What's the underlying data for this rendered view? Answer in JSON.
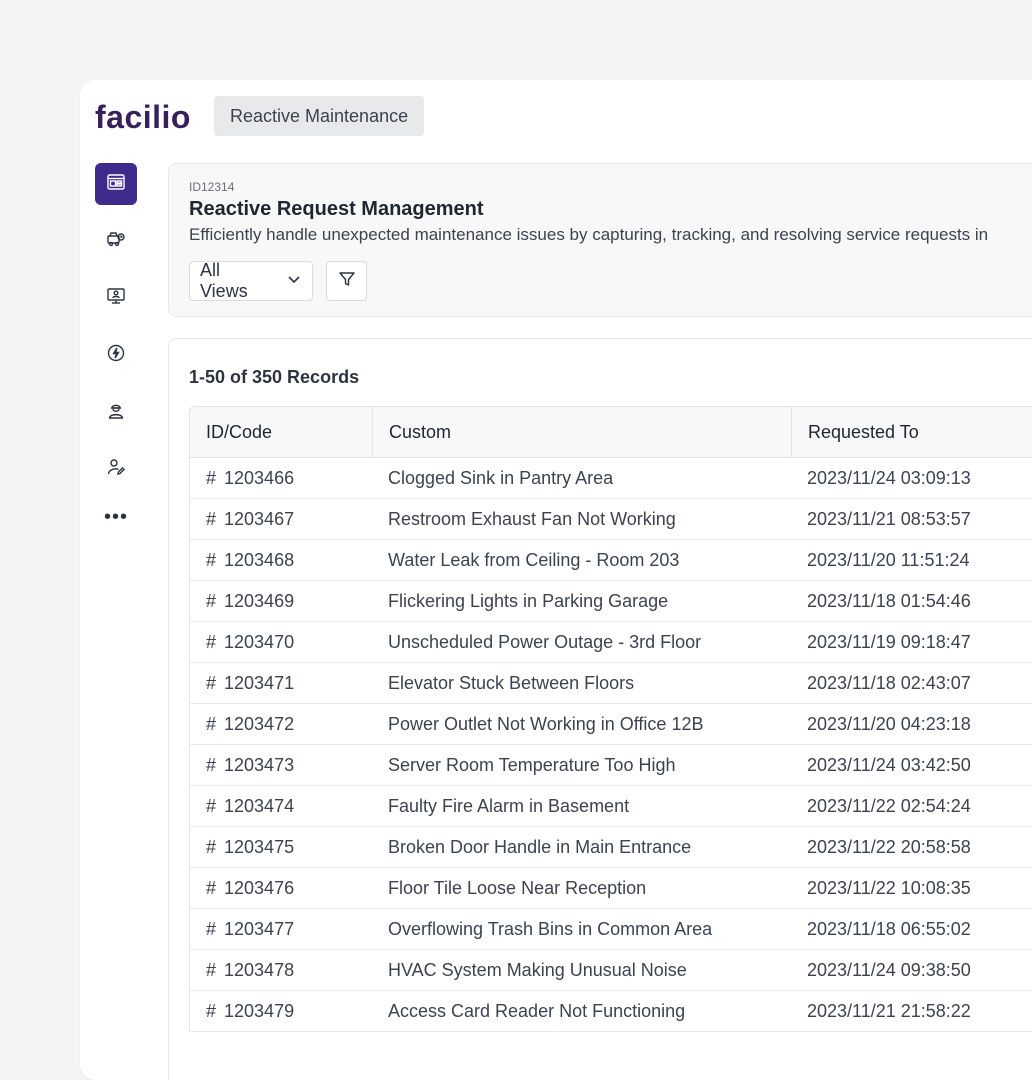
{
  "brand": {
    "name": "facilio",
    "color": "#38205c"
  },
  "module_chip": "Reactive Maintenance",
  "rail": {
    "active_color": "#3f2b8c",
    "items": [
      {
        "icon": "dashboard-icon",
        "active": true
      },
      {
        "icon": "work-vehicle-icon",
        "active": false
      },
      {
        "icon": "monitor-user-icon",
        "active": false
      },
      {
        "icon": "energy-bolt-icon",
        "active": false
      },
      {
        "icon": "technician-icon",
        "active": false
      },
      {
        "icon": "user-edit-icon",
        "active": false
      }
    ],
    "more_label": "•••"
  },
  "header": {
    "record_id": "ID12314",
    "title": "Reactive Request Management",
    "description": "Efficiently handle unexpected maintenance issues by capturing, tracking, and resolving service requests in",
    "views_label": "All Views",
    "filter_icon": "filter-icon"
  },
  "list": {
    "records_label": "1-50 of 350 Records",
    "columns": [
      "ID/Code",
      "Custom",
      "Requested To"
    ],
    "rows": [
      {
        "id": "1203466",
        "subject": "Clogged Sink in Pantry Area",
        "requested": "2023/11/24 03:09:13"
      },
      {
        "id": "1203467",
        "subject": "Restroom Exhaust Fan Not Working",
        "requested": "2023/11/21 08:53:57"
      },
      {
        "id": "1203468",
        "subject": "Water Leak from Ceiling - Room 203",
        "requested": "2023/11/20 11:51:24"
      },
      {
        "id": "1203469",
        "subject": "Flickering Lights in Parking Garage",
        "requested": "2023/11/18 01:54:46"
      },
      {
        "id": "1203470",
        "subject": "Unscheduled Power Outage - 3rd Floor",
        "requested": "2023/11/19 09:18:47"
      },
      {
        "id": "1203471",
        "subject": "Elevator Stuck Between Floors",
        "requested": "2023/11/18 02:43:07"
      },
      {
        "id": "1203472",
        "subject": "Power Outlet Not Working in Office 12B",
        "requested": "2023/11/20 04:23:18"
      },
      {
        "id": "1203473",
        "subject": "Server Room Temperature Too High",
        "requested": "2023/11/24 03:42:50"
      },
      {
        "id": "1203474",
        "subject": "Faulty Fire Alarm in Basement",
        "requested": "2023/11/22 02:54:24"
      },
      {
        "id": "1203475",
        "subject": "Broken Door Handle in Main Entrance",
        "requested": "2023/11/22 20:58:58"
      },
      {
        "id": "1203476",
        "subject": "Floor Tile Loose Near Reception",
        "requested": "2023/11/22 10:08:35"
      },
      {
        "id": "1203477",
        "subject": "Overflowing Trash Bins in Common Area",
        "requested": "2023/11/18 06:55:02"
      },
      {
        "id": "1203478",
        "subject": "HVAC System Making Unusual Noise",
        "requested": "2023/11/24 09:38:50"
      },
      {
        "id": "1203479",
        "subject": "Access Card Reader Not Functioning",
        "requested": "2023/11/21 21:58:22"
      }
    ]
  }
}
